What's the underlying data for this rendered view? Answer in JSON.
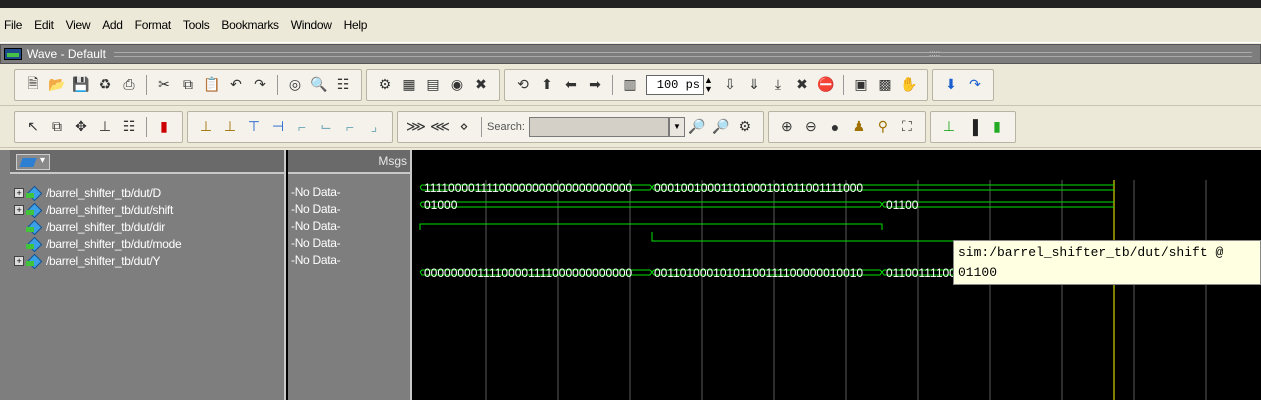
{
  "menu": [
    "File",
    "Edit",
    "View",
    "Add",
    "Format",
    "Tools",
    "Bookmarks",
    "Window",
    "Help"
  ],
  "window": {
    "title": "Wave - Default"
  },
  "toolbar": {
    "time_value": "100 ps",
    "search_label": "Search:"
  },
  "columns": {
    "msgs": "Msgs"
  },
  "signals": [
    {
      "name": "/barrel_shifter_tb/dut/D",
      "value": "-No Data-",
      "expandable": true
    },
    {
      "name": "/barrel_shifter_tb/dut/shift",
      "value": "-No Data-",
      "expandable": true
    },
    {
      "name": "/barrel_shifter_tb/dut/dir",
      "value": "-No Data-",
      "expandable": false
    },
    {
      "name": "/barrel_shifter_tb/dut/mode",
      "value": "-No Data-",
      "expandable": false
    },
    {
      "name": "/barrel_shifter_tb/dut/Y",
      "value": "-No Data-",
      "expandable": true
    }
  ],
  "waves": {
    "D": [
      "11110000111100000000000000000000",
      "00010010001101000101011001111000"
    ],
    "shift": [
      "01000",
      "01100"
    ],
    "Y": [
      "00000000111100001111000000000000",
      "00110100010101100111100000010010",
      "01100111100"
    ]
  },
  "tooltip": {
    "line1": "sim:/barrel_shifter_tb/dut/shift @",
    "line2": "01100"
  },
  "colors": {
    "wave": "#00e000",
    "grid": "#5a5a5a",
    "cursor": "#ffff00"
  }
}
